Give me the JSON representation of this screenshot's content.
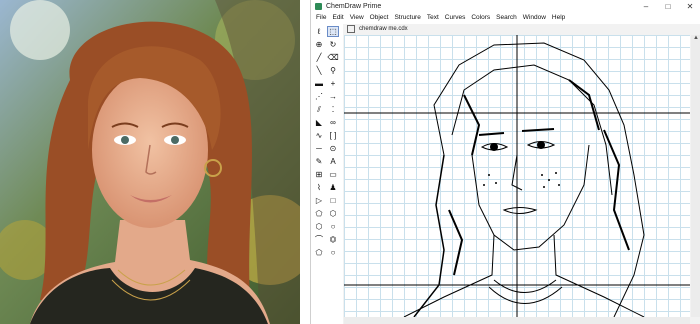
{
  "window": {
    "title": "ChemDraw Prime",
    "minimize": "–",
    "maximize": "□",
    "close": "✕"
  },
  "menu": [
    "File",
    "Edit",
    "View",
    "Object",
    "Structure",
    "Text",
    "Curves",
    "Colors",
    "Search",
    "Window",
    "Help"
  ],
  "document": {
    "tab_title": "chemdraw me.cdx"
  },
  "tools": [
    {
      "icon": "lasso-icon",
      "glyph": "ℓ"
    },
    {
      "icon": "marquee-select-icon",
      "glyph": "⬚"
    },
    {
      "icon": "move-icon",
      "glyph": "⊕"
    },
    {
      "icon": "rotate-icon",
      "glyph": "↻"
    },
    {
      "icon": "pencil-icon",
      "glyph": "╱"
    },
    {
      "icon": "eraser-icon",
      "glyph": "⌫"
    },
    {
      "icon": "bond-icon",
      "glyph": "╲"
    },
    {
      "icon": "zoom-icon",
      "glyph": "⚲"
    },
    {
      "icon": "bold-bond-icon",
      "glyph": "▬"
    },
    {
      "icon": "plus-icon",
      "glyph": "+"
    },
    {
      "icon": "dashed-bond-icon",
      "glyph": "⋰"
    },
    {
      "icon": "arrow-icon",
      "glyph": "→"
    },
    {
      "icon": "hashed-bond-icon",
      "glyph": "⫽"
    },
    {
      "icon": "lone-pair-icon",
      "glyph": "⁚"
    },
    {
      "icon": "wedge-bond-icon",
      "glyph": "◣"
    },
    {
      "icon": "orbital-icon",
      "glyph": "∞"
    },
    {
      "icon": "wavy-bond-icon",
      "glyph": "∿"
    },
    {
      "icon": "bracket-icon",
      "glyph": "[ ]"
    },
    {
      "icon": "bond-line-icon",
      "glyph": "─"
    },
    {
      "icon": "charge-icon",
      "glyph": "⊙"
    },
    {
      "icon": "pen-icon",
      "glyph": "✎"
    },
    {
      "icon": "text-icon",
      "glyph": "A"
    },
    {
      "icon": "table-icon",
      "glyph": "⊞"
    },
    {
      "icon": "template-icon",
      "glyph": "▭"
    },
    {
      "icon": "chain-icon",
      "glyph": "⌇"
    },
    {
      "icon": "atom-icon",
      "glyph": "♟"
    },
    {
      "icon": "triangle-ring-icon",
      "glyph": "▷"
    },
    {
      "icon": "square-ring-icon",
      "glyph": "□"
    },
    {
      "icon": "pentagon-ring-icon",
      "glyph": "⬠"
    },
    {
      "icon": "hexagon-ring-icon",
      "glyph": "⬡"
    },
    {
      "icon": "heptagon-ring-icon",
      "glyph": "⬡"
    },
    {
      "icon": "octagon-ring-icon",
      "glyph": "○"
    },
    {
      "icon": "cyclohexane-chair-icon",
      "glyph": "⌒"
    },
    {
      "icon": "benzene-icon",
      "glyph": "⏣"
    },
    {
      "icon": "cyclopentadiene-icon",
      "glyph": "⬠"
    },
    {
      "icon": "ring-icon",
      "glyph": "○"
    }
  ]
}
